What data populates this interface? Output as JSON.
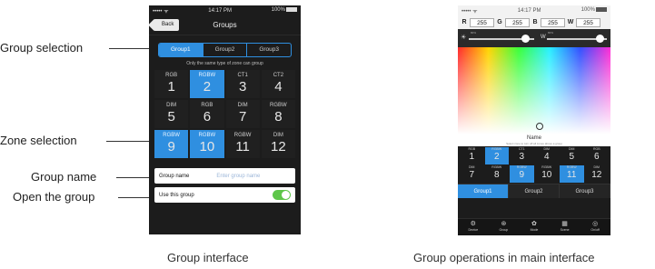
{
  "annotations": {
    "group_selection": "Group selection",
    "zone_selection": "Zone selection",
    "group_name": "Group name",
    "open_group": "Open the group"
  },
  "captions": {
    "left": "Group interface",
    "right": "Group operations in main interface"
  },
  "colors": {
    "accent": "#2f8fe0",
    "toggle_on": "#5ec64a",
    "panel": "#1c1c1c"
  },
  "group_screen": {
    "status": {
      "carrier": "••••• ᯤ",
      "time": "14:17 PM",
      "battery": "100%"
    },
    "nav": {
      "back_label": "Back",
      "title": "Groups"
    },
    "group_tabs": [
      "Group1",
      "Group2",
      "Group3"
    ],
    "hint": "Only the same type of zone can group",
    "zones": [
      {
        "type": "RGB",
        "num": "1",
        "selected": false
      },
      {
        "type": "RGBW",
        "num": "2",
        "selected": true
      },
      {
        "type": "CT1",
        "num": "3",
        "selected": false
      },
      {
        "type": "CT2",
        "num": "4",
        "selected": false
      },
      {
        "type": "DIM",
        "num": "5",
        "selected": false
      },
      {
        "type": "RGB",
        "num": "6",
        "selected": false
      },
      {
        "type": "DIM",
        "num": "7",
        "selected": false
      },
      {
        "type": "RGBW",
        "num": "8",
        "selected": false
      },
      {
        "type": "RGBW",
        "num": "9",
        "selected": true
      },
      {
        "type": "RGBW",
        "num": "10",
        "selected": true
      },
      {
        "type": "RGBW",
        "num": "11",
        "selected": false
      },
      {
        "type": "DIM",
        "num": "12",
        "selected": false
      }
    ],
    "group_name_label": "Group name",
    "group_name_placeholder": "Enter group name",
    "use_group_label": "Use this group",
    "use_group_on": true
  },
  "main_screen": {
    "status": {
      "carrier": "••••• ᯤ",
      "time": "14:17 PM",
      "battery": "100%"
    },
    "rgbw": [
      {
        "label": "R",
        "value": "255"
      },
      {
        "label": "G",
        "value": "255"
      },
      {
        "label": "B",
        "value": "255"
      },
      {
        "label": "W",
        "value": "255"
      }
    ],
    "brightness_pct": "80%",
    "white_pct": "80%",
    "white_label": "W",
    "name_label": "Name",
    "name_sub": "Select zone to turn off all zones above a group",
    "zones": [
      {
        "type": "RGB",
        "num": "1",
        "selected": false
      },
      {
        "type": "RGBW",
        "num": "2",
        "selected": true
      },
      {
        "type": "CT1",
        "num": "3",
        "selected": false
      },
      {
        "type": "DIM",
        "num": "4",
        "selected": false
      },
      {
        "type": "DIM",
        "num": "5",
        "selected": false
      },
      {
        "type": "RGB",
        "num": "6",
        "selected": false
      },
      {
        "type": "DIM",
        "num": "7",
        "selected": false
      },
      {
        "type": "RGBW",
        "num": "8",
        "selected": false
      },
      {
        "type": "RGBW",
        "num": "9",
        "selected": true
      },
      {
        "type": "RGBW",
        "num": "10",
        "selected": false
      },
      {
        "type": "RGBW",
        "num": "11",
        "selected": true
      },
      {
        "type": "DIM",
        "num": "12",
        "selected": false
      }
    ],
    "group_tabs": [
      "Group1",
      "Group2",
      "Group3"
    ],
    "tabbar": [
      {
        "label": "Device",
        "icon": "gear-icon",
        "glyph": "⚙"
      },
      {
        "label": "Group",
        "icon": "group-icon",
        "glyph": "⊛"
      },
      {
        "label": "Mode",
        "icon": "mode-icon",
        "glyph": "✿"
      },
      {
        "label": "Scene",
        "icon": "scene-icon",
        "glyph": "▦"
      },
      {
        "label": "On/off",
        "icon": "bulb-icon",
        "glyph": "◎"
      }
    ]
  }
}
